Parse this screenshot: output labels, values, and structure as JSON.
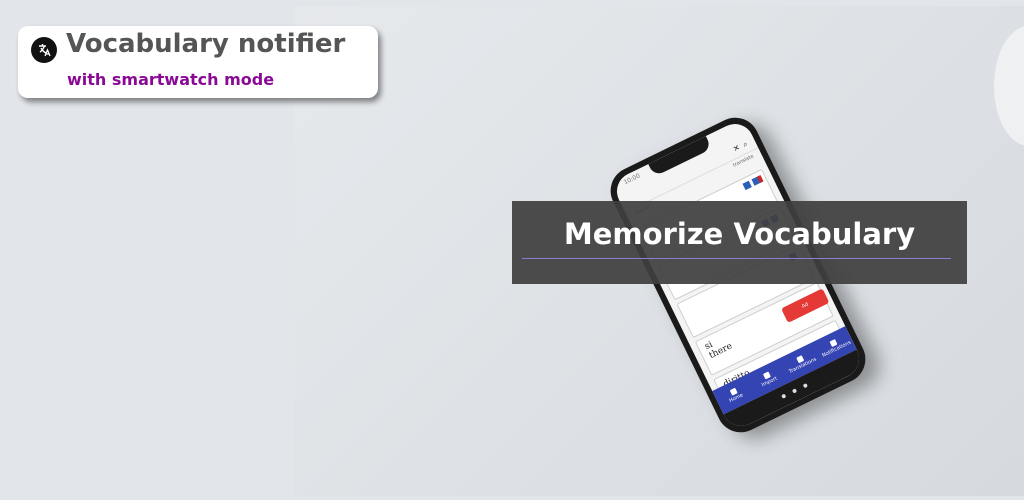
{
  "header": {
    "title": "Vocabulary notifier",
    "subtitle": "with smartwatch mode",
    "logo_icon": "translate-logo-icon"
  },
  "banner": {
    "text": "Memorize Vocabulary"
  },
  "phone": {
    "status_time": "10:00",
    "toolbar_label": "translate",
    "cards": [
      {
        "word": "si",
        "translation": ""
      },
      {
        "word": "there",
        "translation": ""
      },
      {
        "word": "diritto",
        "translation": ""
      }
    ],
    "fab_label": "Ad",
    "bottom_nav": [
      {
        "label": "Home",
        "icon": "home-icon"
      },
      {
        "label": "Import",
        "icon": "import-icon"
      },
      {
        "label": "Translations",
        "icon": "translations-icon"
      },
      {
        "label": "Notifications",
        "icon": "notifications-icon"
      }
    ]
  },
  "colors": {
    "subtitle": "#8a0a96",
    "title": "#555555",
    "nav": "#3444b3",
    "fab": "#e53935"
  }
}
